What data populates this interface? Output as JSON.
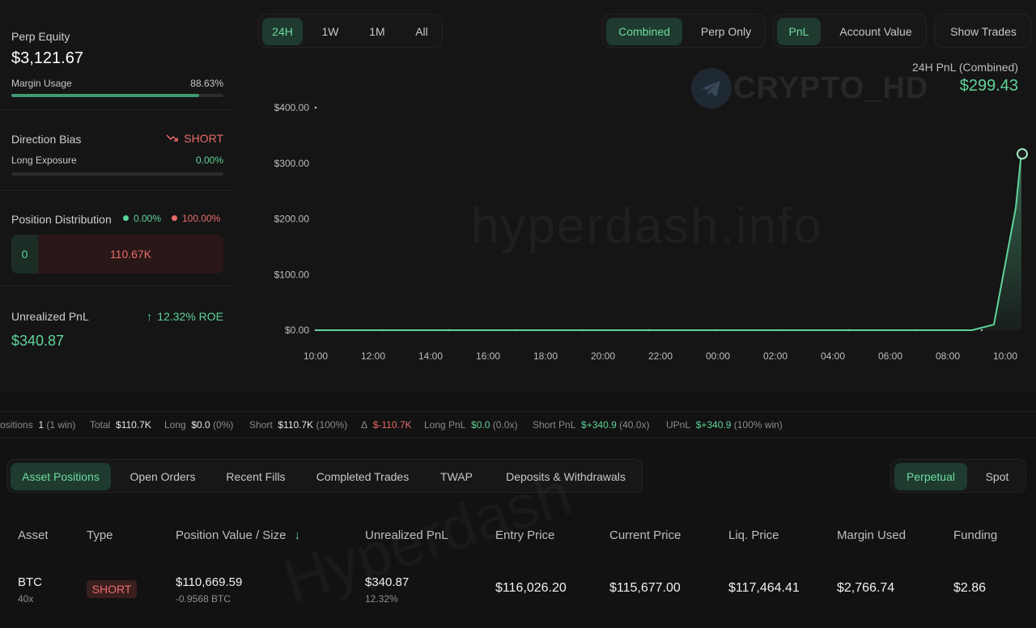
{
  "summary": {
    "perp_equity_label": "Perp Equity",
    "perp_equity_value": "$3,121.67",
    "margin_usage_label": "Margin Usage",
    "margin_usage_value": "88.63%",
    "margin_usage_fraction": 0.8863,
    "direction_bias_label": "Direction Bias",
    "direction_bias_value": "SHORT",
    "long_exposure_label": "Long Exposure",
    "long_exposure_value": "0.00%",
    "long_exposure_fraction": 0,
    "position_distribution_label": "Position Distribution",
    "dist_long_pct": "0.00%",
    "dist_short_pct": "100.00%",
    "dist_long_value": "0",
    "dist_short_value": "110.67K",
    "unrealized_pnl_label": "Unrealized PnL",
    "unrealized_pnl_value": "$340.87",
    "roe_value": "12.32% ROE"
  },
  "time_ranges": [
    "24H",
    "1W",
    "1M",
    "All"
  ],
  "mode_toggle": [
    "Combined",
    "Perp Only"
  ],
  "metric_toggle": [
    "PnL",
    "Account Value"
  ],
  "show_trades_label": "Show Trades",
  "chart_header": {
    "label": "24H PnL (Combined)",
    "value": "$299.43"
  },
  "watermarks": {
    "site": "hyperdash.info",
    "channel": "CRYPTO_HD",
    "table": "Hyperdash"
  },
  "chart_data": {
    "type": "area",
    "x": [
      "10:00",
      "10:45",
      "12:00",
      "13:00",
      "14:00",
      "15:00",
      "16:00",
      "17:00",
      "18:00",
      "19:00",
      "20:00",
      "21:00",
      "22:00",
      "23:00",
      "00:00",
      "01:00",
      "02:00",
      "03:00",
      "04:00",
      "05:00",
      "06:00",
      "07:00",
      "08:00",
      "09:00",
      "09:50",
      "10:00",
      "10:20",
      "10:35"
    ],
    "values": [
      0,
      0,
      0,
      0,
      0,
      0,
      0,
      0,
      0,
      0,
      0,
      0,
      0,
      0,
      0,
      0,
      0,
      0,
      0,
      0,
      0,
      0,
      0,
      0,
      0,
      10,
      220,
      320
    ],
    "last_point": 299.43,
    "tick_labels_x": [
      "10:00",
      "12:00",
      "14:00",
      "16:00",
      "18:00",
      "20:00",
      "22:00",
      "00:00",
      "02:00",
      "04:00",
      "06:00",
      "08:00",
      "10:00"
    ],
    "tick_labels_y": [
      "$400.00",
      "$300.00",
      "$200.00",
      "$100.00",
      "$0.00"
    ],
    "ylim": [
      0,
      400
    ],
    "color": "#5fd39a"
  },
  "stats_bar": {
    "positions_label": "ositions",
    "positions_value": "1",
    "positions_sub": "(1 win)",
    "total_label": "Total",
    "total_value": "$110.7K",
    "long_label": "Long",
    "long_value": "$0.0",
    "long_sub": "(0%)",
    "short_label": "Short",
    "short_value": "$110.7K",
    "short_sub": "(100%)",
    "delta_label": "Δ",
    "delta_value": "$-110.7K",
    "long_pnl_label": "Long PnL",
    "long_pnl_value": "$0.0",
    "long_pnl_sub": "(0.0x)",
    "short_pnl_label": "Short PnL",
    "short_pnl_value": "$+340.9",
    "short_pnl_sub": "(40.0x)",
    "upnl_label": "UPnL",
    "upnl_value": "$+340.9",
    "upnl_sub": "(100% win)"
  },
  "bottom_tabs": [
    "Asset Positions",
    "Open Orders",
    "Recent Fills",
    "Completed Trades",
    "TWAP",
    "Deposits & Withdrawals"
  ],
  "market_toggle": [
    "Perpetual",
    "Spot"
  ],
  "table": {
    "headers": [
      "Asset",
      "Type",
      "Position Value / Size",
      "Unrealized PnL",
      "Entry Price",
      "Current Price",
      "Liq. Price",
      "Margin Used",
      "Funding"
    ],
    "row": {
      "asset": "BTC",
      "leverage": "40x",
      "type": "SHORT",
      "position_value": "$110,669.59",
      "size": "-0.9568 BTC",
      "upnl": "$340.87",
      "upnl_pct": "12.32%",
      "entry_price": "$116,026.20",
      "current_price": "$115,677.00",
      "liq_price": "$117,464.41",
      "margin_used": "$2,766.74",
      "funding": "$2.86"
    }
  }
}
